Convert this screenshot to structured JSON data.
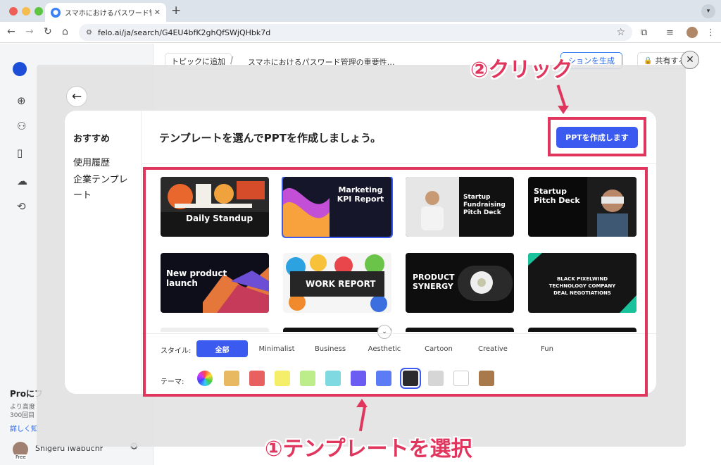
{
  "browser": {
    "tab_title": "スマホにおけるパスワード管理の",
    "url": "felo.ai/ja/search/G4EU4bfK2ghQfSWjQHbk7d"
  },
  "sidebar": {
    "pro_title": "Proにフ",
    "pro_desc_1": "より高度",
    "pro_desc_2": "300回目",
    "pro_link": "詳しく知",
    "user_name": "Shigeru Iwabuchi",
    "free_badge": "Free"
  },
  "header": {
    "topic_button": "トピックに追加",
    "breadcrumb": "スマホにおけるパスワード管理の重要性…",
    "generate_button": "ションを生成",
    "share_button": "共有する"
  },
  "modal": {
    "side_items": [
      "おすすめ",
      "使用履歴",
      "企業テンプレート"
    ],
    "title": "テンプレートを選んでPPTを作成しましょう。",
    "create_button": "PPTを作成します",
    "templates": [
      {
        "title": "Daily Standup",
        "bg": "#1a1a1a"
      },
      {
        "title": "Marketing KPI Report",
        "bg": "#1b1b2a"
      },
      {
        "title": "Startup Fundraising Pitch Deck",
        "bg": "#111"
      },
      {
        "title": "Startup Pitch Deck",
        "bg": "#0a0a0a"
      },
      {
        "title": "New product launch",
        "bg": "#0e0e1a"
      },
      {
        "title": "WORK REPORT",
        "bg": "#222"
      },
      {
        "title": "PRODUCT SYNERGY",
        "bg": "#0e0e0e"
      },
      {
        "title": "BLACK PIXELWIND TECHNOLOGY COMPANY DEAL NEGOTIATIONS",
        "bg": "#151515"
      }
    ],
    "style_label": "スタイル:",
    "styles": [
      "全部",
      "Minimalist",
      "Business",
      "Aesthetic",
      "Cartoon",
      "Creative",
      "Fun"
    ],
    "theme_label": "テーマ:",
    "theme_colors": [
      "#e8b960",
      "#e86060",
      "#f4ee6a",
      "#bdec8a",
      "#7fd9e0",
      "#6d5cf2",
      "#5b7cf5",
      "#2b2b2e",
      "#d6d6d6",
      "#ffffff",
      "#a8794a"
    ]
  },
  "annotations": {
    "step2": "②クリック",
    "step1": "①テンプレートを選択"
  }
}
